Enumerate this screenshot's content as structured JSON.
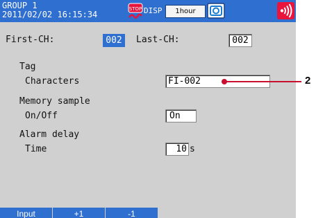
{
  "header": {
    "group": "GROUP 1",
    "datetime": "2011/02/02 16:15:34",
    "stop_badge": "STOP",
    "disp": "DISP",
    "period": "1hour",
    "icons": [
      "stop-icon",
      "camera-icon",
      "alarm-icon"
    ],
    "colors": {
      "bar": "#2f6fd0",
      "alarm": "#e8143c"
    }
  },
  "channels": {
    "first_label": "First-CH:",
    "first_value": "002",
    "last_label": "Last-CH:",
    "last_value": "002"
  },
  "tag": {
    "heading": "Tag",
    "characters_label": "Characters",
    "characters_value": "FI-002"
  },
  "memory_sample": {
    "heading": "Memory sample",
    "onoff_label": "On/Off",
    "onoff_value": "On"
  },
  "alarm_delay": {
    "heading": "Alarm delay",
    "time_label": "Time",
    "time_value": "10",
    "time_unit": "s"
  },
  "callout": "2",
  "softkeys": [
    "Input",
    "+1",
    "-1"
  ]
}
